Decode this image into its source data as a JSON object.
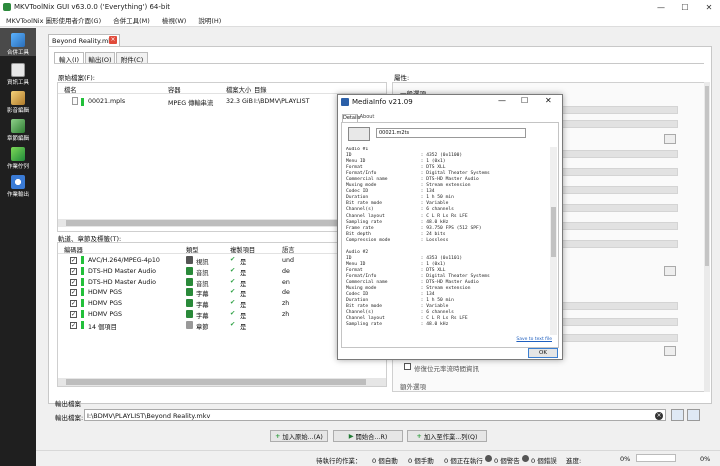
{
  "window": {
    "title": "MKVToolNix GUI v63.0.0 ('Everything') 64-bit"
  },
  "menu": [
    "MKVToolNix 圖形使用者介面(G)",
    "合併工具(M)",
    "檢視(W)",
    "說明(H)"
  ],
  "sidebar": [
    {
      "label": "合併工具",
      "icon": "merge-icon",
      "active": true
    },
    {
      "label": "資訊工具",
      "icon": "info-tool-icon"
    },
    {
      "label": "影音編輯",
      "icon": "header-editor-icon"
    },
    {
      "label": "章節編輯",
      "icon": "chapter-editor-icon"
    },
    {
      "label": "作業佇列",
      "icon": "job-queue-icon"
    },
    {
      "label": "作業輸出",
      "icon": "job-output-icon"
    }
  ],
  "doc_tab": {
    "label": "Beyond Reality.mkv",
    "close": "×"
  },
  "subtabs": [
    "輸入(I)",
    "輸出(O)",
    "附件(C)"
  ],
  "source_files": {
    "label": "原始檔案(F):",
    "columns": [
      "檔名",
      "容器",
      "檔案大小",
      "目錄"
    ],
    "rows": [
      {
        "name": "00021.mpls",
        "container": "MPEG 傳輸串流",
        "size": "32.3 GiB",
        "dir": "I:\\BDMV\\PLAYLIST"
      }
    ]
  },
  "tracks": {
    "label": "軌道、章節及標籤(T):",
    "columns": [
      "編碼器",
      "類型",
      "複製項目",
      "語言"
    ],
    "rows": [
      {
        "codec": "AVC/H.264/MPEG-4p10",
        "type": "視訊",
        "copy": "是",
        "lang": "und",
        "icon": "video-icon"
      },
      {
        "codec": "DTS-HD Master Audio",
        "type": "音訊",
        "copy": "是",
        "lang": "de",
        "icon": "audio-icon"
      },
      {
        "codec": "DTS-HD Master Audio",
        "type": "音訊",
        "copy": "是",
        "lang": "en",
        "icon": "audio-icon"
      },
      {
        "codec": "HDMV PGS",
        "type": "字幕",
        "copy": "是",
        "lang": "de",
        "icon": "subtitle-icon"
      },
      {
        "codec": "HDMV PGS",
        "type": "字幕",
        "copy": "是",
        "lang": "zh",
        "icon": "subtitle-icon"
      },
      {
        "codec": "HDMV PGS",
        "type": "字幕",
        "copy": "是",
        "lang": "zh",
        "icon": "subtitle-icon"
      },
      {
        "codec": "14 個項目",
        "type": "章節",
        "copy": "是",
        "lang": "",
        "icon": "chapter-icon"
      }
    ]
  },
  "properties": {
    "label": "屬性:",
    "section1": "一般選項",
    "checkbox": "修復位元率流時間資訊",
    "bottom_label": "額外選項"
  },
  "output": {
    "label": "輸出檔案",
    "field_label": "輸出檔案:",
    "value": "I:\\BDMV\\PLAYLIST\\Beyond Reality.mkv"
  },
  "buttons": [
    "加入原始...(A)",
    "開始合...R)",
    "加入至作業...列(Q)"
  ],
  "status": {
    "jobs": "待執行的作業：",
    "auto": "0 個自動",
    "manual": "0 個手動",
    "running": "0 個正在執行",
    "warnings": "0 個警告",
    "errors": "0 個錯誤",
    "progress_label": "進度:",
    "p1": "0%",
    "p2": "0%"
  },
  "mediainfo": {
    "title": "MediaInfo v21.09",
    "tabs": [
      "Details",
      "About"
    ],
    "file": "00021.m2ts",
    "lines": [
      "Audio #1",
      "ID                         : 4352 (0x1100)",
      "Menu ID                    : 1 (0x1)",
      "Format                     : DTS XLL",
      "Format/Info                : Digital Theater Systems",
      "Commercial name            : DTS-HD Master Audio",
      "Muxing mode                : Stream extension",
      "Codec ID                   : 134",
      "Duration                   : 1 h 50 min",
      "Bit rate mode              : Variable",
      "Channel(s)                 : 6 channels",
      "Channel layout             : C L R Ls Rs LFE",
      "Sampling rate              : 48.0 kHz",
      "Frame rate                 : 93.750 FPS (512 SPF)",
      "Bit depth                  : 24 bits",
      "Compression mode           : Lossless",
      "",
      "Audio #2",
      "ID                         : 4353 (0x1101)",
      "Menu ID                    : 1 (0x1)",
      "Format                     : DTS XLL",
      "Format/Info                : Digital Theater Systems",
      "Commercial name            : DTS-HD Master Audio",
      "Muxing mode                : Stream extension",
      "Codec ID                   : 134",
      "Duration                   : 1 h 50 min",
      "Bit rate mode              : Variable",
      "Channel(s)                 : 6 channels",
      "Channel layout             : C L R Ls Rs LFE",
      "Sampling rate              : 48.0 kHz"
    ],
    "save_link": "Save to text file",
    "ok": "OK"
  }
}
